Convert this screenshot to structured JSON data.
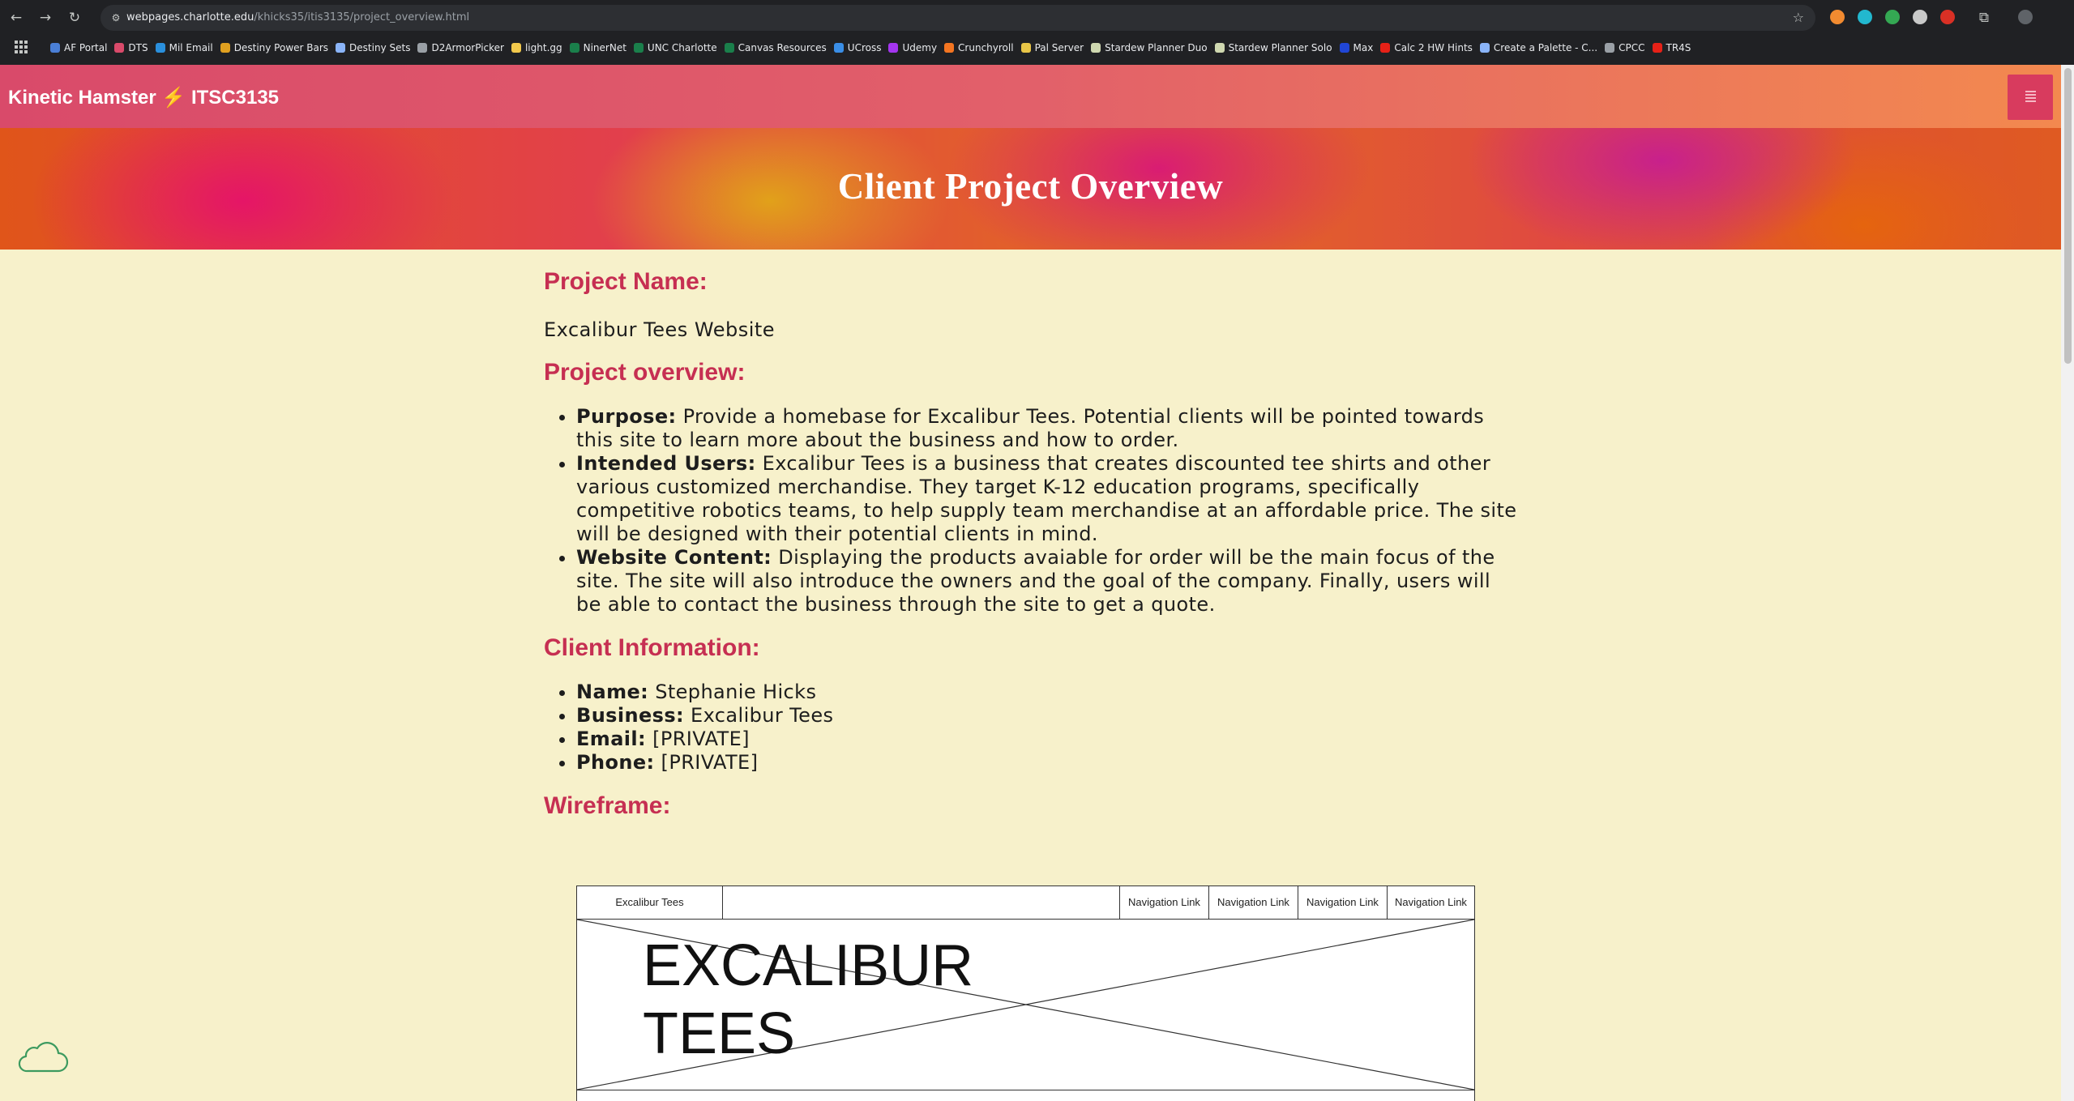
{
  "browser": {
    "url_host": "webpages.charlotte.edu",
    "url_path": "/khicks35/itis3135/project_overview.html",
    "bookmarks": [
      {
        "label": "AF Portal",
        "color": "#4a7fd6"
      },
      {
        "label": "DTS",
        "color": "#d94a6a"
      },
      {
        "label": "Mil Email",
        "color": "#2a8fdc"
      },
      {
        "label": "Destiny Power Bars",
        "color": "#e0a020"
      },
      {
        "label": "Destiny Sets",
        "color": "#8ab4f8"
      },
      {
        "label": "D2ArmorPicker",
        "color": "#9aa0a6"
      },
      {
        "label": "light.gg",
        "color": "#f2c94c"
      },
      {
        "label": "NinerNet",
        "color": "#1a7f4b"
      },
      {
        "label": "UNC Charlotte",
        "color": "#1a7f4b"
      },
      {
        "label": "Canvas Resources",
        "color": "#1a7f4b"
      },
      {
        "label": "UCross",
        "color": "#3a8ee6"
      },
      {
        "label": "Udemy",
        "color": "#a435f0"
      },
      {
        "label": "Crunchyroll",
        "color": "#f47521"
      },
      {
        "label": "Pal Server",
        "color": "#e8c547"
      },
      {
        "label": "Stardew Planner Duo",
        "color": "#cfd8b0"
      },
      {
        "label": "Stardew Planner Solo",
        "color": "#cfd8b0"
      },
      {
        "label": "Max",
        "color": "#2046d6"
      },
      {
        "label": "Calc 2 HW Hints",
        "color": "#e62117"
      },
      {
        "label": "Create a Palette - C...",
        "color": "#8ab4f8"
      },
      {
        "label": "CPCC",
        "color": "#9aa0a6"
      },
      {
        "label": "TR4S",
        "color": "#e62117"
      }
    ],
    "extension_colors": [
      "#f28b30",
      "#22b8cf",
      "#34a853",
      "#c9c9c9",
      "#d93025"
    ]
  },
  "header": {
    "brand": "Kinetic Hamster ⚡ ITSC3135"
  },
  "hero": {
    "title": "Client Project Overview"
  },
  "project_name": {
    "heading": "Project Name:",
    "value": "Excalibur Tees Website"
  },
  "overview": {
    "heading": "Project overview:",
    "items": [
      {
        "label": "Purpose:",
        "text": " Provide a homebase for Excalibur Tees. Potential clients will be pointed towards this site to learn more about the business and how to order."
      },
      {
        "label": "Intended Users:",
        "text": " Excalibur Tees is a business that creates discounted tee shirts and other various customized merchandise. They target K-12 education programs, specifically competitive robotics teams, to help supply team merchandise at an affordable price. The site will be designed with their potential clients in mind."
      },
      {
        "label": "Website Content:",
        "text": " Displaying the products avaiable for order will be the main focus of the site. The site will also introduce the owners and the goal of the company. Finally, users will be able to contact the business through the site to get a quote."
      }
    ]
  },
  "client": {
    "heading": "Client Information:",
    "items": [
      {
        "label": "Name:",
        "text": " Stephanie Hicks"
      },
      {
        "label": "Business:",
        "text": " Excalibur Tees"
      },
      {
        "label": "Email:",
        "text": " [PRIVATE]"
      },
      {
        "label": "Phone:",
        "text": " [PRIVATE]"
      }
    ]
  },
  "wireframe": {
    "heading": "Wireframe:",
    "logo_cell": "Excalibur Tees",
    "nav_links": [
      "Navigation Link",
      "Navigation Link",
      "Navigation Link",
      "Navigation Link"
    ],
    "hero_line1": "EXCALIBUR",
    "hero_line2": "TEES"
  }
}
